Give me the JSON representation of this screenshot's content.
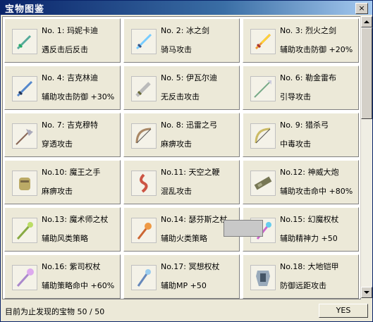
{
  "window": {
    "title": "宝物图鉴",
    "close_label": "×"
  },
  "items": [
    {
      "title": "No. 1: 玛妮卡迪",
      "desc": "遇反击后反击",
      "icon": "green-sword-icon"
    },
    {
      "title": "No. 2: 冰之剑",
      "desc": "骑马攻击",
      "icon": "ice-sword-icon"
    },
    {
      "title": "No. 3: 烈火之剑",
      "desc": "辅助攻击防御 +20%",
      "icon": "fire-sword-icon"
    },
    {
      "title": "No. 4: 吉克林迪",
      "desc": "辅助攻击防御 +30%",
      "icon": "blue-sword-icon"
    },
    {
      "title": "No. 5: 伊瓦尔迪",
      "desc": "无反击攻击",
      "icon": "broad-sword-icon"
    },
    {
      "title": "No. 6: 勒金雷布",
      "desc": "引导攻击",
      "icon": "spear-icon"
    },
    {
      "title": "No. 7: 吉克穆特",
      "desc": "穿透攻击",
      "icon": "halberd-icon"
    },
    {
      "title": "No. 8: 迅雷之弓",
      "desc": "麻痹攻击",
      "icon": "bow-icon"
    },
    {
      "title": "No. 9: 猎杀弓",
      "desc": "中毒攻击",
      "icon": "golden-bow-icon"
    },
    {
      "title": "No.10: 魔王之手",
      "desc": "麻痹攻击",
      "icon": "gauntlet-icon"
    },
    {
      "title": "No.11: 天空之鞭",
      "desc": "混乱攻击",
      "icon": "whip-icon"
    },
    {
      "title": "No.12: 神威大炮",
      "desc": "辅助攻击命中 +80%",
      "icon": "cannon-icon"
    },
    {
      "title": "No.13: 魔术师之杖",
      "desc": "辅助风类策略",
      "icon": "green-staff-icon"
    },
    {
      "title": "No.14: 瑟芬斯之杖",
      "desc": "辅助火类策略",
      "icon": "fire-staff-icon"
    },
    {
      "title": "No.15: 幻魔权杖",
      "desc": "辅助精神力 +50",
      "icon": "magic-scepter-icon"
    },
    {
      "title": "No.16: 紫司权杖",
      "desc": "辅助策略命中 +60%",
      "icon": "purple-scepter-icon"
    },
    {
      "title": "No.17: 冥想权杖",
      "desc": "辅助MP +50",
      "icon": "meditation-scepter-icon"
    },
    {
      "title": "No.18: 大地铠甲",
      "desc": "防御远距攻击",
      "icon": "armor-icon"
    }
  ],
  "status": {
    "text": "目前为止发现的宝物 50 / 50"
  },
  "buttons": {
    "yes_label": "YES"
  },
  "colors": {
    "titlebar": "#0A246A",
    "panel": "#ECE9D8",
    "content_bg": "#FFFFFF"
  }
}
